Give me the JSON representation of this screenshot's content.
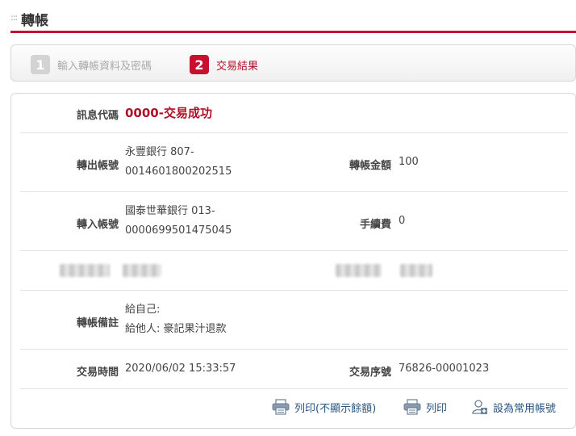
{
  "header": {
    "dots": ":::",
    "title": "轉帳"
  },
  "steps": [
    {
      "num": "1",
      "label": "輸入轉帳資料及密碼"
    },
    {
      "num": "2",
      "label": "交易結果"
    }
  ],
  "result": {
    "message_label": "訊息代碼",
    "message_value": "0000-交易成功",
    "from_label": "轉出帳號",
    "from_line1": "永豐銀行 807-",
    "from_line2": "0014601800202515",
    "amount_label": "轉帳金額",
    "amount_value": "100",
    "to_label": "轉入帳號",
    "to_line1": "國泰世華銀行 013-",
    "to_line2": "0000699501475045",
    "fee_label": "手續費",
    "fee_value": "0",
    "note_label": "轉帳備註",
    "note_self": "給自己:",
    "note_other": "給他人: 豪記果汁退款",
    "time_label": "交易時間",
    "time_value": "2020/06/02 15:33:57",
    "seq_label": "交易序號",
    "seq_value": "76826-00001023"
  },
  "actions": {
    "print_no_balance": "列印(不顯示餘額)",
    "print": "列印",
    "set_common": "設為常用帳號"
  },
  "colors": {
    "accent": "#c8102e",
    "link": "#2a5580"
  }
}
